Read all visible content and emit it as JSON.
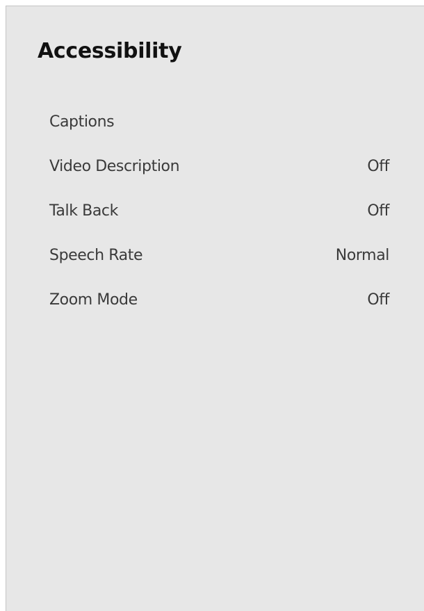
{
  "header": {
    "title": "Accessibility"
  },
  "menu": {
    "items": [
      {
        "label": "Captions",
        "value": ""
      },
      {
        "label": "Video Description",
        "value": "Off"
      },
      {
        "label": "Talk Back",
        "value": "Off"
      },
      {
        "label": "Speech Rate",
        "value": "Normal"
      },
      {
        "label": "Zoom Mode",
        "value": "Off"
      }
    ]
  },
  "colors": {
    "panel_background": "#e7e7e7",
    "title_text": "#111111",
    "item_text": "#3a3a3a"
  }
}
